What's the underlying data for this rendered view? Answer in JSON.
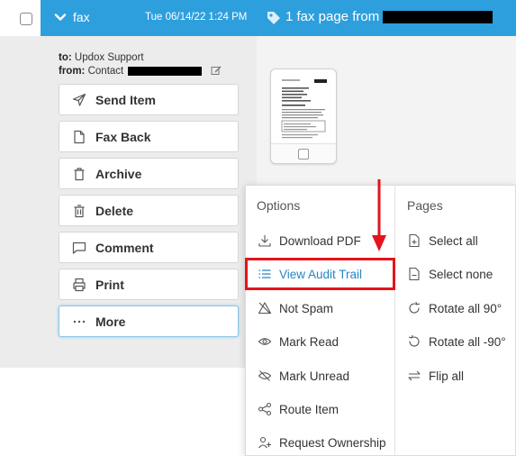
{
  "header": {
    "type_label": "fax",
    "date": "Tue 06/14/22 1:24 PM",
    "subject_prefix": "1 fax page from",
    "header_color": "#2e9fdd"
  },
  "details": {
    "to_key": "to:",
    "to_value": "Updox Support",
    "from_key": "from:",
    "from_value": "Contact"
  },
  "actions": [
    {
      "label": "Send Item",
      "icon": "send-icon"
    },
    {
      "label": "Fax Back",
      "icon": "document-icon"
    },
    {
      "label": "Archive",
      "icon": "archive-icon"
    },
    {
      "label": "Delete",
      "icon": "trash-icon"
    },
    {
      "label": "Comment",
      "icon": "comment-icon"
    },
    {
      "label": "Print",
      "icon": "printer-icon"
    },
    {
      "label": "More",
      "icon": "ellipsis-icon"
    }
  ],
  "menu": {
    "options_heading": "Options",
    "pages_heading": "Pages",
    "options": [
      {
        "label": "Download PDF",
        "icon": "download-icon"
      },
      {
        "label": "View Audit Trail",
        "icon": "list-icon"
      },
      {
        "label": "Not Spam",
        "icon": "not-spam-icon"
      },
      {
        "label": "Mark Read",
        "icon": "eye-icon"
      },
      {
        "label": "Mark Unread",
        "icon": "eye-slash-icon"
      },
      {
        "label": "Route Item",
        "icon": "share-icon"
      },
      {
        "label": "Request Ownership",
        "icon": "user-plus-icon"
      }
    ],
    "pages": [
      {
        "label": "Select all",
        "icon": "select-all-icon"
      },
      {
        "label": "Select none",
        "icon": "select-none-icon"
      },
      {
        "label": "Rotate all 90°",
        "icon": "rotate-cw-icon"
      },
      {
        "label": "Rotate all -90°",
        "icon": "rotate-ccw-icon"
      },
      {
        "label": "Flip all",
        "icon": "flip-icon"
      }
    ],
    "highlight_color": "#e3141b",
    "highlight_text_color": "#2585c7"
  }
}
